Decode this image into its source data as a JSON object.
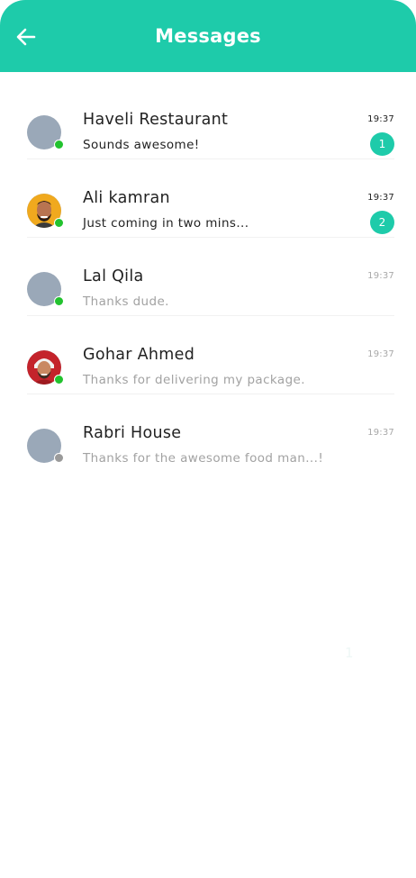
{
  "header": {
    "title": "Messages",
    "bg_color": "#1ecbaa",
    "back_icon": "arrow-left-icon"
  },
  "colors": {
    "accent": "#1ecbaa",
    "online": "#22c22e",
    "offline": "#9a9a9a",
    "avatar_placeholder": "#9aa8b8"
  },
  "conversations": [
    {
      "name": "Haveli Restaurant",
      "preview": "Sounds awesome!",
      "time": "19:37",
      "unread": "1",
      "status": "online",
      "avatar": "placeholder"
    },
    {
      "name": "Ali kamran",
      "preview": "Just coming in two mins...",
      "time": "19:37",
      "unread": "2",
      "status": "online",
      "avatar": "photo"
    },
    {
      "name": "Lal Qila",
      "preview": "Thanks dude.",
      "time": "19:37",
      "unread": "",
      "status": "online",
      "avatar": "placeholder"
    },
    {
      "name": "Gohar Ahmed",
      "preview": "Thanks for delivering my package.",
      "time": "19:37",
      "unread": "",
      "status": "online",
      "avatar": "photo"
    },
    {
      "name": "Rabri House",
      "preview": "Thanks for the awesome food man...!",
      "time": "19:37",
      "unread": "",
      "status": "offline",
      "avatar": "placeholder"
    }
  ],
  "ghost_text": "1"
}
